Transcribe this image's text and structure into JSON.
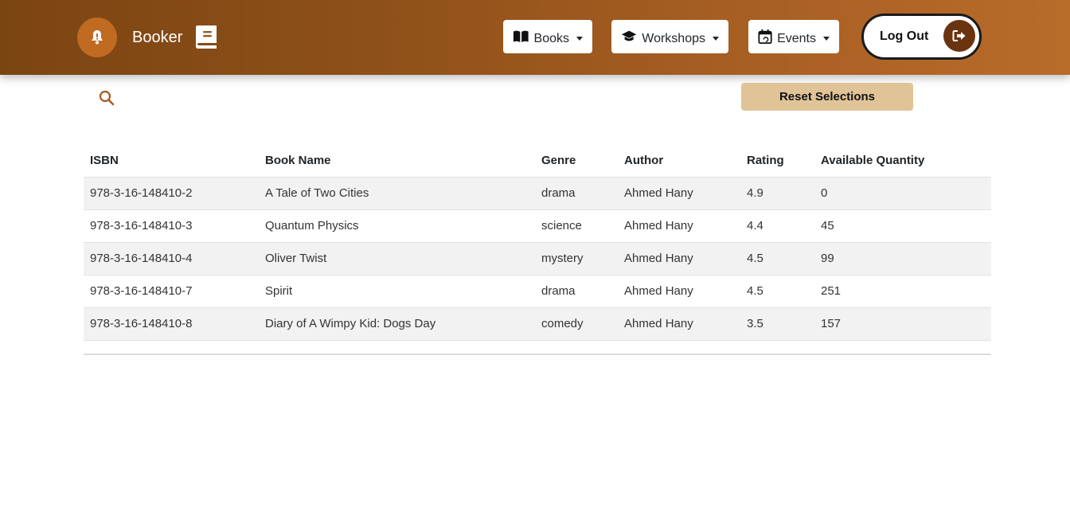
{
  "app": {
    "brand": "Booker"
  },
  "nav": {
    "books_label": "Books",
    "workshops_label": "Workshops",
    "events_label": "Events",
    "logout_label": "Log Out"
  },
  "toolbar": {
    "reset_label": "Reset Selections",
    "search_icon": "search-icon"
  },
  "table": {
    "headers": [
      "ISBN",
      "Book Name",
      "Genre",
      "Author",
      "Rating",
      "Available Quantity"
    ],
    "rows": [
      [
        "978-3-16-148410-2",
        "A Tale of Two Cities",
        "drama",
        "Ahmed Hany",
        "4.9",
        "0"
      ],
      [
        "978-3-16-148410-3",
        "Quantum Physics",
        "science",
        "Ahmed Hany",
        "4.4",
        "45"
      ],
      [
        "978-3-16-148410-4",
        "Oliver Twist",
        "mystery",
        "Ahmed Hany",
        "4.5",
        "99"
      ],
      [
        "978-3-16-148410-7",
        "Spirit",
        "drama",
        "Ahmed Hany",
        "4.5",
        "251"
      ],
      [
        "978-3-16-148410-8",
        "Diary of A Wimpy Kid: Dogs Day",
        "comedy",
        "Ahmed Hany",
        "3.5",
        "157"
      ]
    ]
  },
  "colors": {
    "header_start": "#7b4512",
    "header_end": "#b86c2a",
    "accent": "#c06a22",
    "reset_bg": "#e0c497",
    "logout_circle": "#6b3410"
  }
}
